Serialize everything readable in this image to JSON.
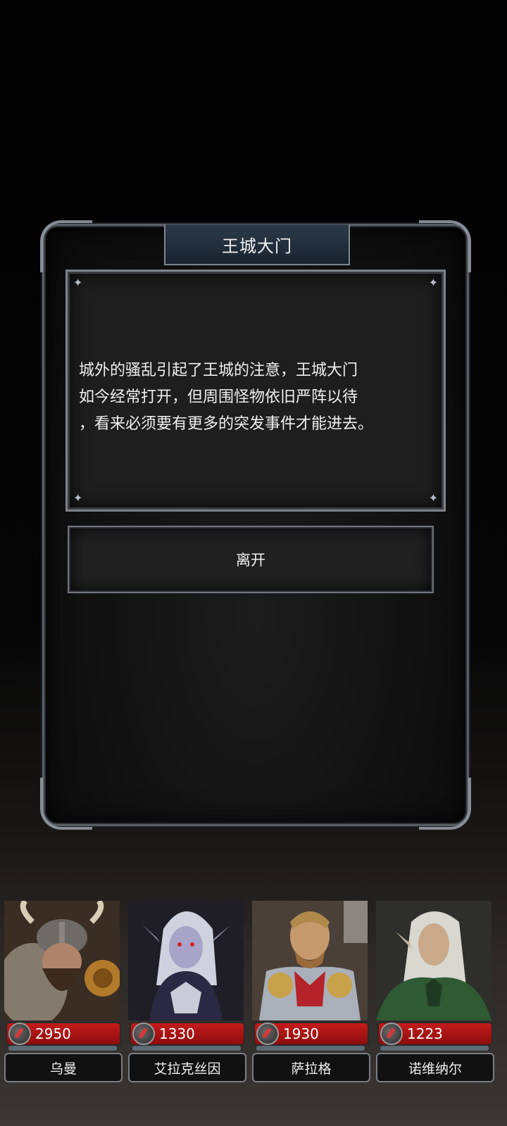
{
  "event": {
    "title": "王城大门",
    "description_lines": [
      "城外的骚乱引起了王城的注意，王城大门",
      "如今经常打开，但周围怪物依旧严阵以待",
      "，看来必须要有更多的突发事件才能进去。"
    ],
    "leave_label": "离开"
  },
  "party": [
    {
      "name": "乌曼",
      "hp": "2950",
      "portrait_icon": "dwarf-warrior-portrait",
      "bg": "#4a3a2c"
    },
    {
      "name": "艾拉克丝因",
      "hp": "1330",
      "portrait_icon": "dark-elf-portrait",
      "bg": "#2b2a35"
    },
    {
      "name": "萨拉格",
      "hp": "1930",
      "portrait_icon": "paladin-portrait",
      "bg": "#6d5a44"
    },
    {
      "name": "诺维纳尔",
      "hp": "1223",
      "portrait_icon": "elf-ranger-portrait",
      "bg": "#3a3a34"
    }
  ]
}
